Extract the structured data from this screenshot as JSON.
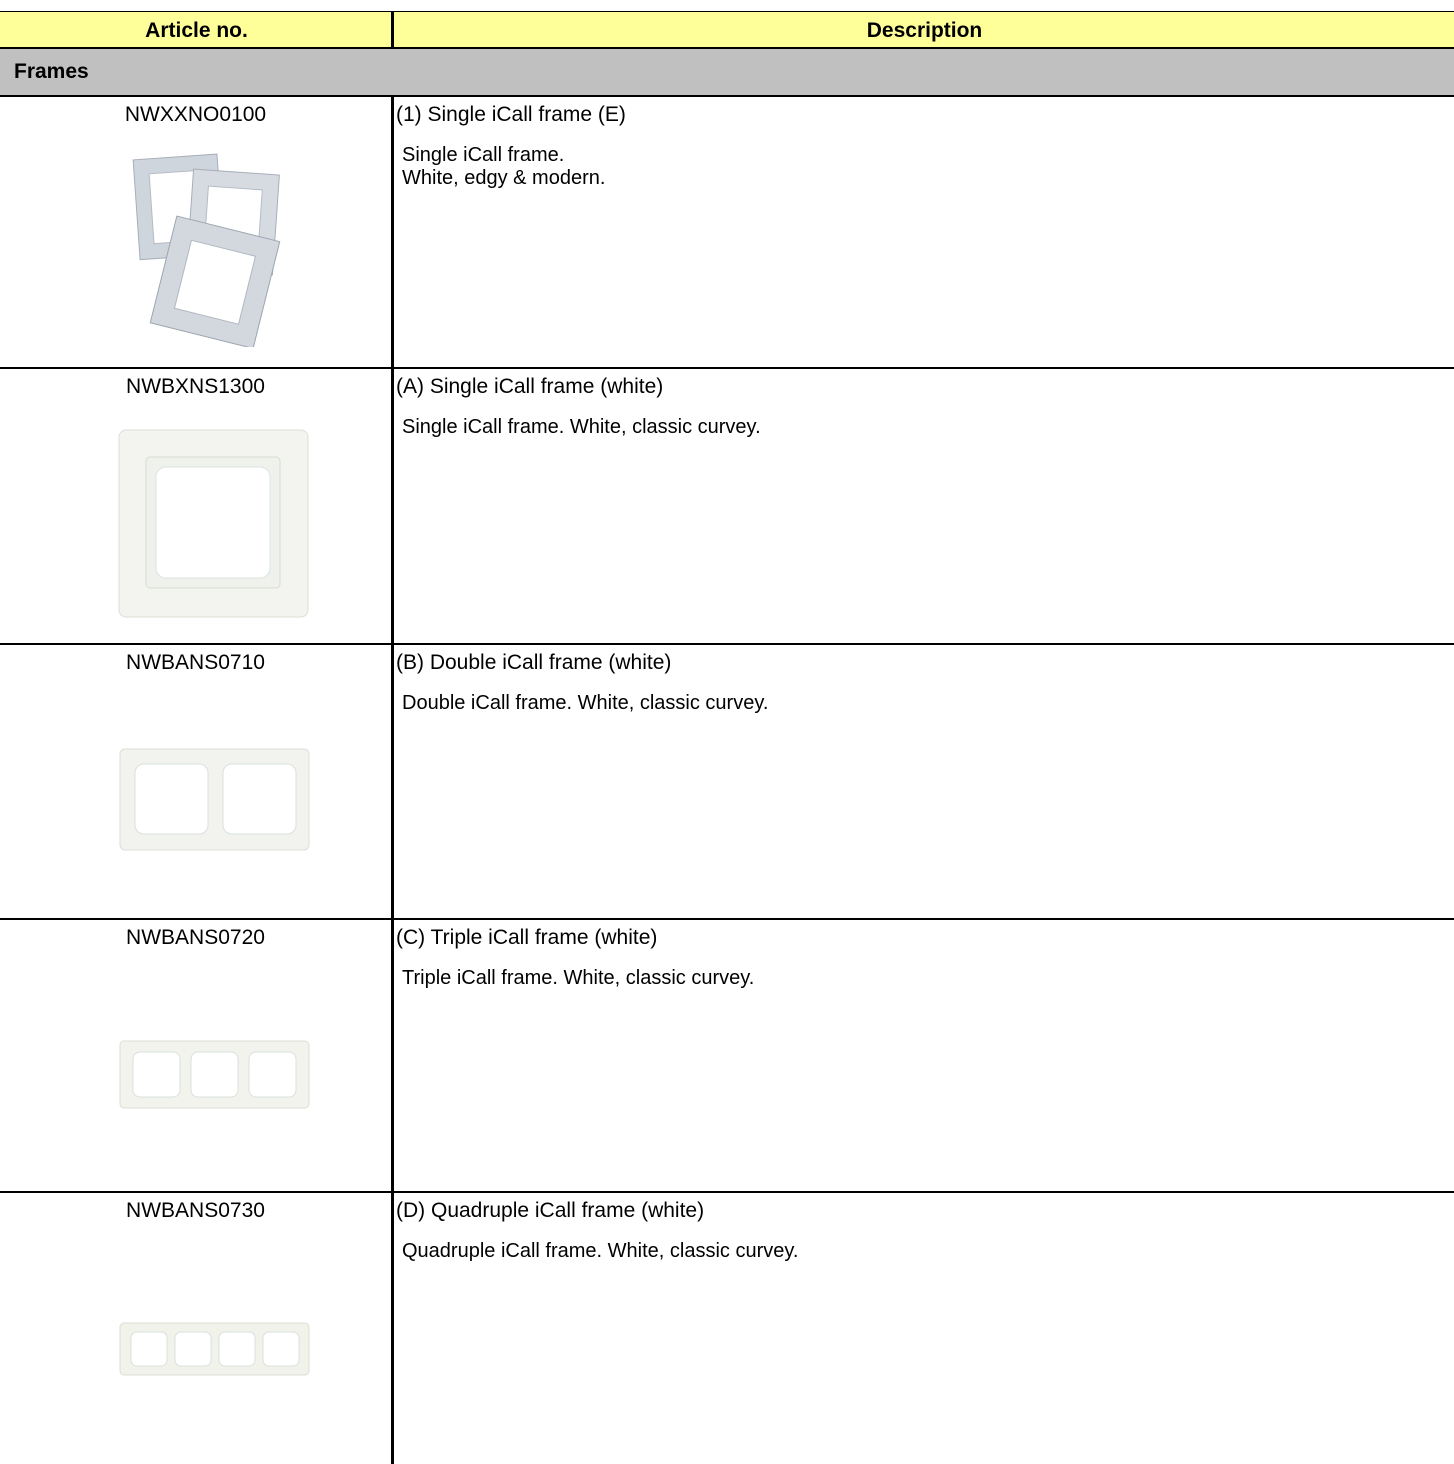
{
  "table": {
    "headers": {
      "article": "Article no.",
      "description": "Description"
    },
    "section_title": "Frames",
    "rows": [
      {
        "article": "NWXXNO0100",
        "title": "(1) Single iCall frame (E)",
        "description": "Single iCall frame.\nWhite, edgy & modern.",
        "image_icon": "stacked-frames-image"
      },
      {
        "article": "NWBXNS1300",
        "title": "(A) Single iCall frame (white)",
        "description": "Single iCall frame. White, classic curvey.",
        "image_icon": "single-frame-image"
      },
      {
        "article": "NWBANS0710",
        "title": "(B) Double iCall frame (white)",
        "description": "Double iCall frame. White, classic curvey.",
        "image_icon": "double-frame-image"
      },
      {
        "article": "NWBANS0720",
        "title": "(C) Triple iCall frame (white)",
        "description": "Triple iCall frame. White, classic curvey.",
        "image_icon": "triple-frame-image"
      },
      {
        "article": "NWBANS0730",
        "title": "(D) Quadruple iCall frame (white)",
        "description": "Quadruple iCall frame. White, classic curvey.",
        "image_icon": "quadruple-frame-image"
      }
    ]
  },
  "colors": {
    "header_bg": "#ffff99",
    "section_bg": "#c0c0c0",
    "border": "#000000"
  }
}
